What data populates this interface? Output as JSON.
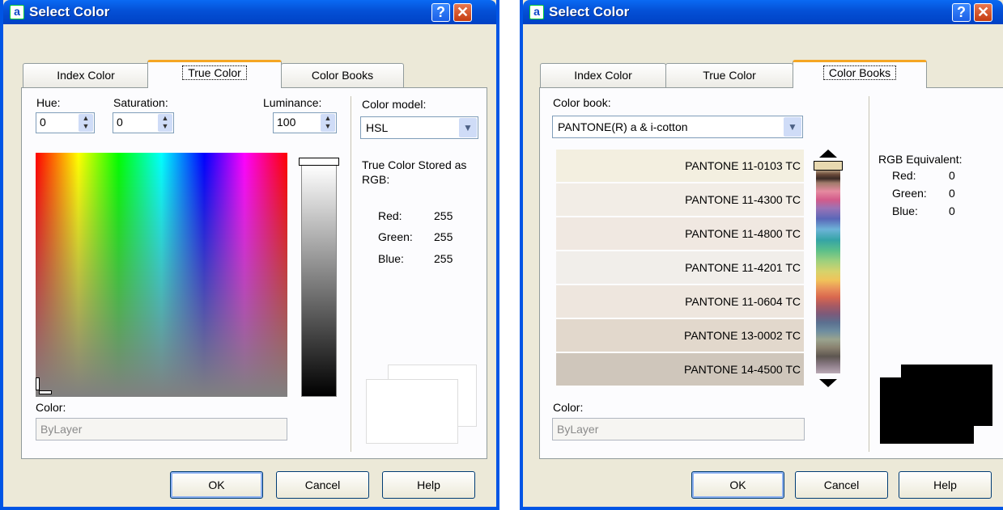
{
  "left": {
    "title": "Select Color",
    "icon_letter": "a",
    "help_glyph": "?",
    "close_glyph": "✕",
    "tabs": [
      {
        "label": "Index Color",
        "active": false
      },
      {
        "label": "True Color",
        "active": true
      },
      {
        "label": "Color Books",
        "active": false
      }
    ],
    "hue": {
      "label": "Hue:",
      "value": "0"
    },
    "saturation": {
      "label": "Saturation:",
      "value": "0"
    },
    "luminance": {
      "label": "Luminance:",
      "value": "100"
    },
    "color_model": {
      "label": "Color model:",
      "value": "HSL"
    },
    "stored_label": "True Color Stored as RGB:",
    "rgb": {
      "red_label": "Red:",
      "red": "255",
      "green_label": "Green:",
      "green": "255",
      "blue_label": "Blue:",
      "blue": "255"
    },
    "color_field": {
      "label": "Color:",
      "value": "ByLayer"
    },
    "buttons": {
      "ok": "OK",
      "cancel": "Cancel",
      "help": "Help"
    }
  },
  "right": {
    "title": "Select Color",
    "icon_letter": "a",
    "help_glyph": "?",
    "close_glyph": "✕",
    "tabs": [
      {
        "label": "Index Color",
        "active": false
      },
      {
        "label": "True Color",
        "active": false
      },
      {
        "label": "Color Books",
        "active": true
      }
    ],
    "color_book": {
      "label": "Color book:",
      "value": "PANTONE(R) a & i-cotton"
    },
    "swatches": [
      {
        "name": "PANTONE 11-0103 TC",
        "color": "#f3efe0"
      },
      {
        "name": "PANTONE 11-4300 TC",
        "color": "#f2ede6"
      },
      {
        "name": "PANTONE 11-4800 TC",
        "color": "#f0e8e1"
      },
      {
        "name": "PANTONE 11-4201 TC",
        "color": "#f1eeea"
      },
      {
        "name": "PANTONE 11-0604 TC",
        "color": "#eee6de"
      },
      {
        "name": "PANTONE 13-0002 TC",
        "color": "#e2d8cc"
      },
      {
        "name": "PANTONE 14-4500 TC",
        "color": "#cfc6bb"
      }
    ],
    "rgb_equivalent": {
      "label": "RGB Equivalent:",
      "red_label": "Red:",
      "red": "0",
      "green_label": "Green:",
      "green": "0",
      "blue_label": "Blue:",
      "blue": "0"
    },
    "color_field": {
      "label": "Color:",
      "value": "ByLayer"
    },
    "buttons": {
      "ok": "OK",
      "cancel": "Cancel",
      "help": "Help"
    }
  },
  "colors": {
    "title_blue": "#0055e5",
    "dialog_bg": "#ece9d8",
    "tab_accent": "#f5a623"
  }
}
